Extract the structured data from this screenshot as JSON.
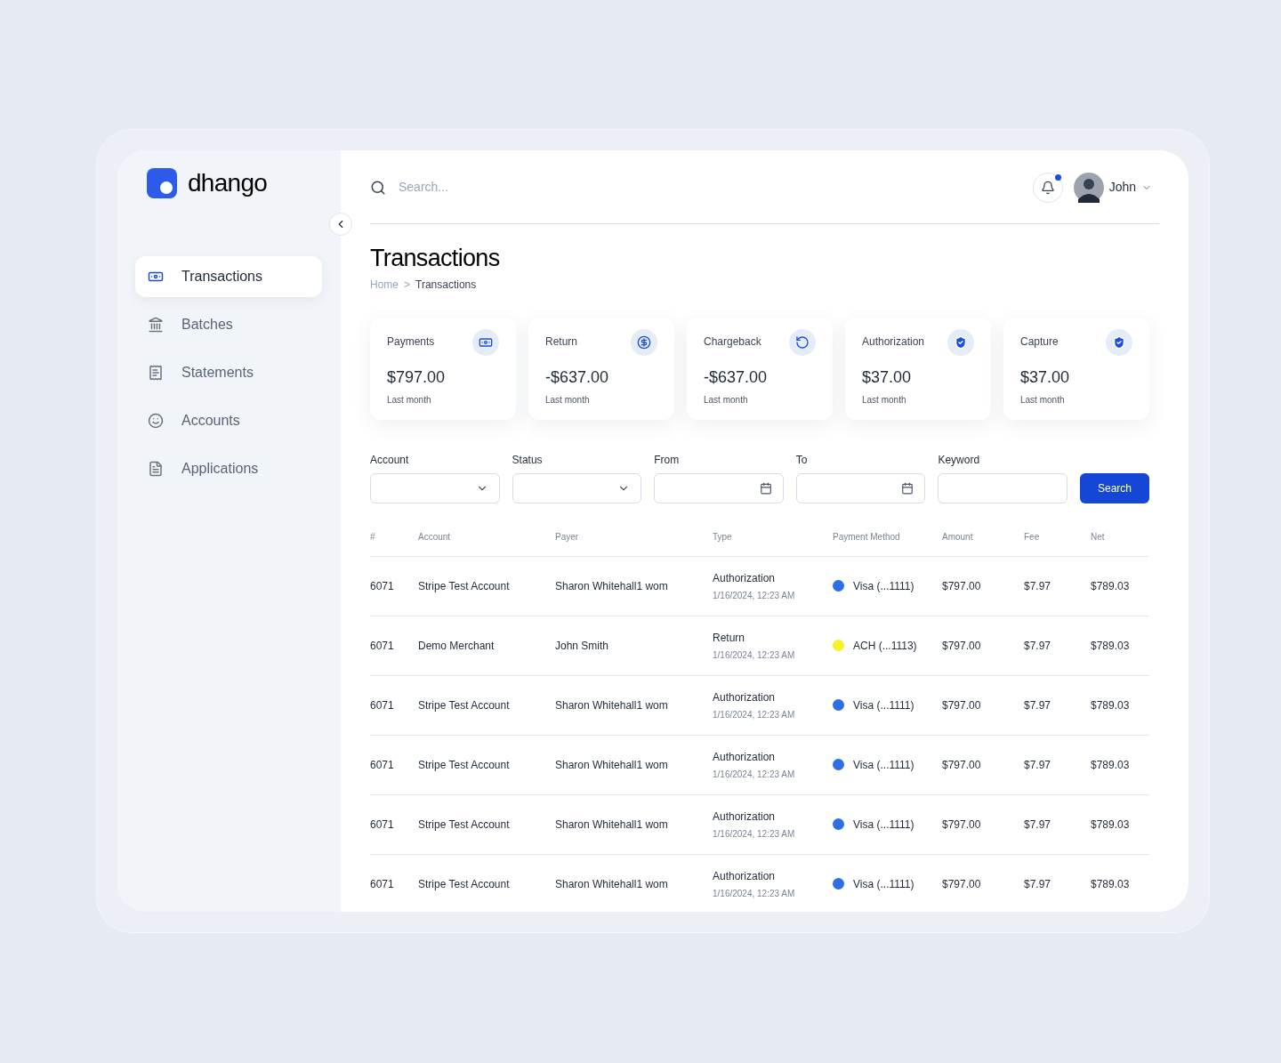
{
  "brand": {
    "name": "dhango"
  },
  "sidebar": {
    "items": [
      {
        "label": "Transactions",
        "selected": true
      },
      {
        "label": "Batches",
        "selected": false
      },
      {
        "label": "Statements",
        "selected": false
      },
      {
        "label": "Accounts",
        "selected": false
      },
      {
        "label": "Applications",
        "selected": false
      }
    ]
  },
  "header": {
    "search": {
      "placeholder": "Search..."
    },
    "notifications": {
      "unread": true
    },
    "user": {
      "name": "John"
    }
  },
  "page": {
    "title": "Transactions",
    "breadcrumb": [
      "Home",
      ">",
      "Transactions"
    ]
  },
  "cards": [
    {
      "kind": "payments",
      "title": "Payments",
      "value": "$797.00",
      "caption": "Last month"
    },
    {
      "kind": "return",
      "title": "Return",
      "value": "-$637.00",
      "caption": "Last month"
    },
    {
      "kind": "chargeback",
      "title": "Chargeback",
      "value": "-$637.00",
      "caption": "Last month"
    },
    {
      "kind": "shield",
      "title": "Authorization",
      "value": "$37.00",
      "caption": "Last month"
    },
    {
      "kind": "shield",
      "title": "Capture",
      "value": "$37.00",
      "caption": "Last month"
    }
  ],
  "filters": [
    {
      "kind": "select",
      "label": "Account"
    },
    {
      "kind": "select",
      "label": "Status"
    },
    {
      "kind": "date",
      "label": "From"
    },
    {
      "kind": "date",
      "label": "To"
    },
    {
      "kind": "text",
      "label": "Keyword"
    }
  ],
  "search_button": "Search",
  "table": {
    "columns": [
      "#",
      "Account",
      "Payer",
      "Type",
      "Payment Method",
      "Amount",
      "Fee",
      "Net"
    ],
    "rows": [
      {
        "id": "6071",
        "account": "Stripe Test Account",
        "payer": "Sharon Whitehall1 wom",
        "type": "Authorization",
        "date": "1/16/2024, 12:23 AM",
        "method": "Visa (...1111)",
        "color": "#2f6fe4",
        "amount": "$797.00",
        "fee": "$7.97",
        "net": "$789.03"
      },
      {
        "id": "6071",
        "account": "Demo Merchant",
        "payer": "John Smith",
        "type": "Return",
        "date": "1/16/2024, 12:23 AM",
        "method": "ACH (...1113)",
        "color": "#f5f228",
        "amount": "$797.00",
        "fee": "$7.97",
        "net": "$789.03"
      },
      {
        "id": "6071",
        "account": "Stripe Test Account",
        "payer": "Sharon Whitehall1 wom",
        "type": "Authorization",
        "date": "1/16/2024, 12:23 AM",
        "method": "Visa (...1111)",
        "color": "#2f6fe4",
        "amount": "$797.00",
        "fee": "$7.97",
        "net": "$789.03"
      },
      {
        "id": "6071",
        "account": "Stripe Test Account",
        "payer": "Sharon Whitehall1 wom",
        "type": "Authorization",
        "date": "1/16/2024, 12:23 AM",
        "method": "Visa (...1111)",
        "color": "#2f6fe4",
        "amount": "$797.00",
        "fee": "$7.97",
        "net": "$789.03"
      },
      {
        "id": "6071",
        "account": "Stripe Test Account",
        "payer": "Sharon Whitehall1 wom",
        "type": "Authorization",
        "date": "1/16/2024, 12:23 AM",
        "method": "Visa (...1111)",
        "color": "#2f6fe4",
        "amount": "$797.00",
        "fee": "$7.97",
        "net": "$789.03"
      },
      {
        "id": "6071",
        "account": "Stripe Test Account",
        "payer": "Sharon Whitehall1 wom",
        "type": "Authorization",
        "date": "1/16/2024, 12:23 AM",
        "method": "Visa (...1111)",
        "color": "#2f6fe4",
        "amount": "$797.00",
        "fee": "$7.97",
        "net": "$789.03"
      }
    ]
  }
}
